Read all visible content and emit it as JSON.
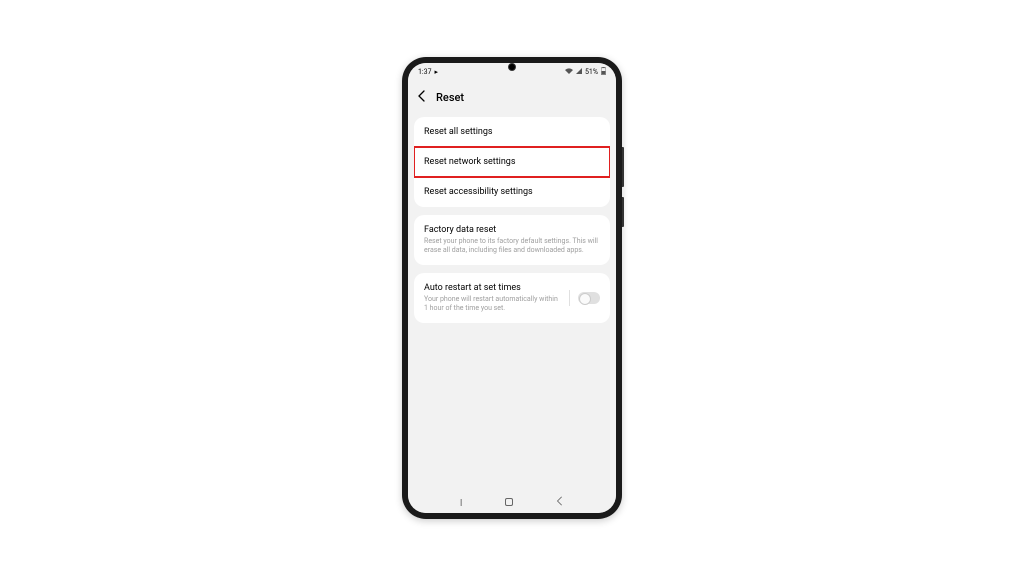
{
  "statusBar": {
    "time": "1:37",
    "batteryText": "51%"
  },
  "header": {
    "title": "Reset"
  },
  "groups": [
    {
      "items": [
        {
          "title": "Reset all settings"
        },
        {
          "title": "Reset network settings",
          "highlighted": true
        },
        {
          "title": "Reset accessibility settings"
        }
      ]
    },
    {
      "items": [
        {
          "title": "Factory data reset",
          "description": "Reset your phone to its factory default settings. This will erase all data, including files and downloaded apps."
        }
      ]
    },
    {
      "items": [
        {
          "title": "Auto restart at set times",
          "description": "Your phone will restart automatically within 1 hour of the time you set.",
          "toggle": false
        }
      ]
    }
  ]
}
